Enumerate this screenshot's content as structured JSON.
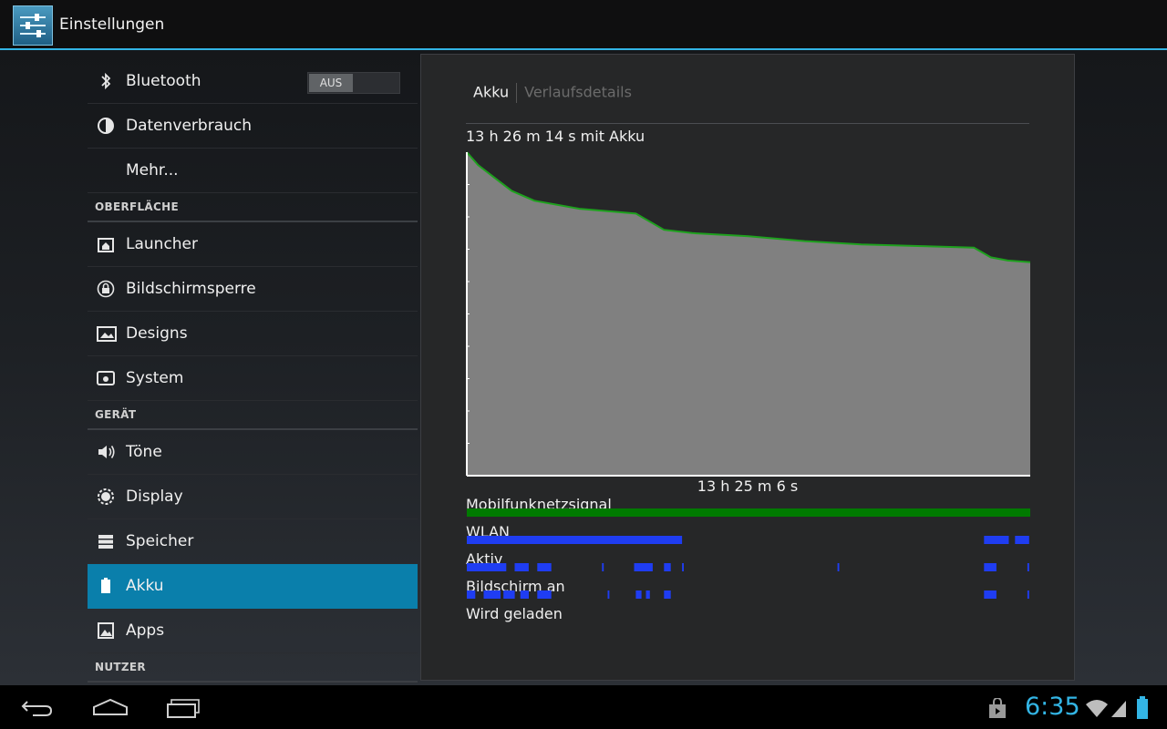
{
  "actionbar": {
    "title": "Einstellungen",
    "icon": "settings-sliders-icon"
  },
  "sidebar": {
    "bluetooth": {
      "label": "Bluetooth",
      "toggle": "AUS",
      "icon": "bluetooth-icon"
    },
    "data_usage": {
      "label": "Datenverbrauch",
      "icon": "data-usage-icon"
    },
    "more": {
      "label": "Mehr..."
    },
    "header_ui": "OBERFLÄCHE",
    "launcher": {
      "label": "Launcher",
      "icon": "launcher-icon"
    },
    "lockscreen": {
      "label": "Bildschirmsperre",
      "icon": "lock-icon"
    },
    "designs": {
      "label": "Designs",
      "icon": "designs-icon"
    },
    "system": {
      "label": "System",
      "icon": "system-icon"
    },
    "header_device": "GERÄT",
    "sound": {
      "label": "Töne",
      "icon": "speaker-icon"
    },
    "display": {
      "label": "Display",
      "icon": "brightness-icon"
    },
    "storage": {
      "label": "Speicher",
      "icon": "storage-icon"
    },
    "battery": {
      "label": "Akku",
      "icon": "battery-icon",
      "selected": true
    },
    "apps": {
      "label": "Apps",
      "icon": "apps-icon"
    },
    "header_user": "NUTZER"
  },
  "panel": {
    "breadcrumb": {
      "current": "Akku",
      "next": "Verlaufsdetails"
    },
    "summary": "13 h 26 m 14 s mit Akku",
    "duration": "13 h 25 m 6 s",
    "rows": [
      "Mobilfunknetzsignal",
      "WLAN",
      "Aktiv",
      "Bildschirm an",
      "Wird geladen"
    ]
  },
  "chart_data": {
    "type": "area",
    "x": [
      0,
      0.02,
      0.05,
      0.08,
      0.12,
      0.2,
      0.3,
      0.35,
      0.4,
      0.5,
      0.6,
      0.7,
      0.8,
      0.9,
      0.93,
      0.96,
      1.0
    ],
    "values": [
      100,
      96,
      92,
      88,
      85,
      82.5,
      81,
      76,
      75,
      74,
      72.5,
      71.5,
      71,
      70.5,
      67.5,
      66.5,
      66
    ],
    "ylim": [
      0,
      100
    ],
    "line_color": "#1ea11e",
    "fill_color": "#808080"
  },
  "tracks": {
    "signal": {
      "color": "#007a00",
      "segments": [
        [
          0,
          1
        ]
      ]
    },
    "wlan": {
      "color": "#1f3df2",
      "segments": [
        [
          0,
          0.382
        ],
        [
          0.918,
          0.962
        ],
        [
          0.973,
          0.998
        ]
      ]
    },
    "active": {
      "color": "#1f3df2",
      "segments": [
        [
          0,
          0.07
        ],
        [
          0.085,
          0.11
        ],
        [
          0.125,
          0.15
        ],
        [
          0.24,
          0.243
        ],
        [
          0.297,
          0.33
        ],
        [
          0.35,
          0.362
        ],
        [
          0.382,
          0.385
        ],
        [
          0.658,
          0.661
        ],
        [
          0.918,
          0.94
        ],
        [
          0.995,
          0.998
        ]
      ]
    },
    "screen": {
      "color": "#1f3df2",
      "segments": [
        [
          0,
          0.015
        ],
        [
          0.03,
          0.06
        ],
        [
          0.065,
          0.085
        ],
        [
          0.095,
          0.11
        ],
        [
          0.125,
          0.15
        ],
        [
          0.25,
          0.253
        ],
        [
          0.3,
          0.31
        ],
        [
          0.318,
          0.325
        ],
        [
          0.35,
          0.362
        ],
        [
          0.918,
          0.94
        ],
        [
          0.995,
          0.998
        ]
      ]
    },
    "charging": {
      "color": "#1f3df2",
      "segments": []
    }
  },
  "statusbar": {
    "time": "6:35",
    "icons": [
      "shop-icon",
      "wifi-icon",
      "signal-icon",
      "battery-icon"
    ]
  },
  "navbar": {
    "icons": [
      "back-icon",
      "home-icon",
      "recents-icon"
    ]
  }
}
